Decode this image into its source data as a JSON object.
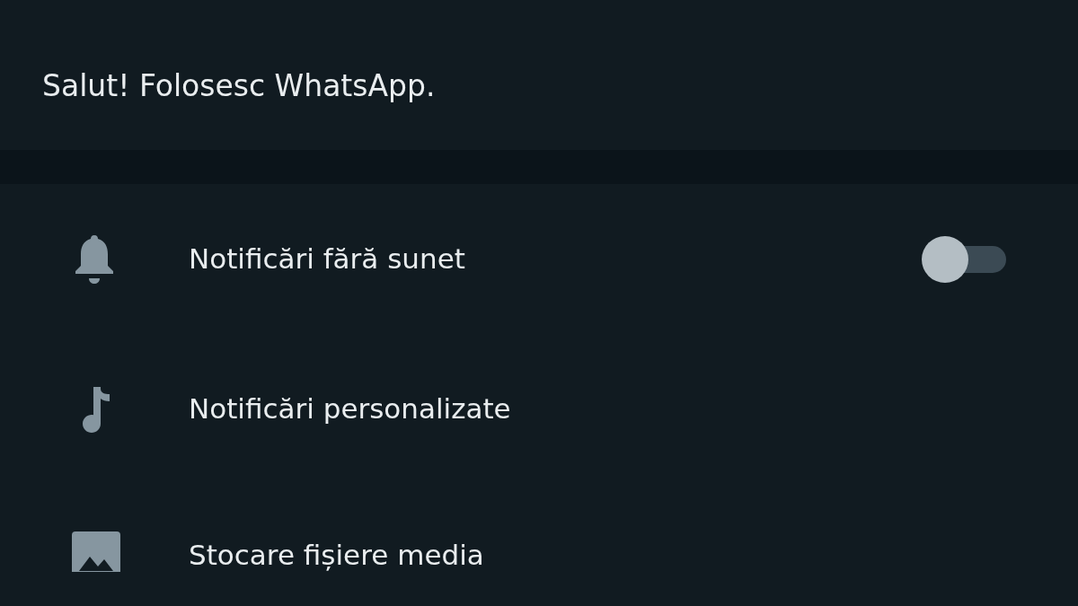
{
  "about": {
    "text": "Salut! Folosesc WhatsApp."
  },
  "settings": [
    {
      "kind": "toggle",
      "label": "Notificări fără sunet",
      "on": false
    },
    {
      "kind": "link",
      "label": "Notificări personalizate"
    },
    {
      "kind": "link",
      "label": "Stocare fișiere media"
    }
  ]
}
